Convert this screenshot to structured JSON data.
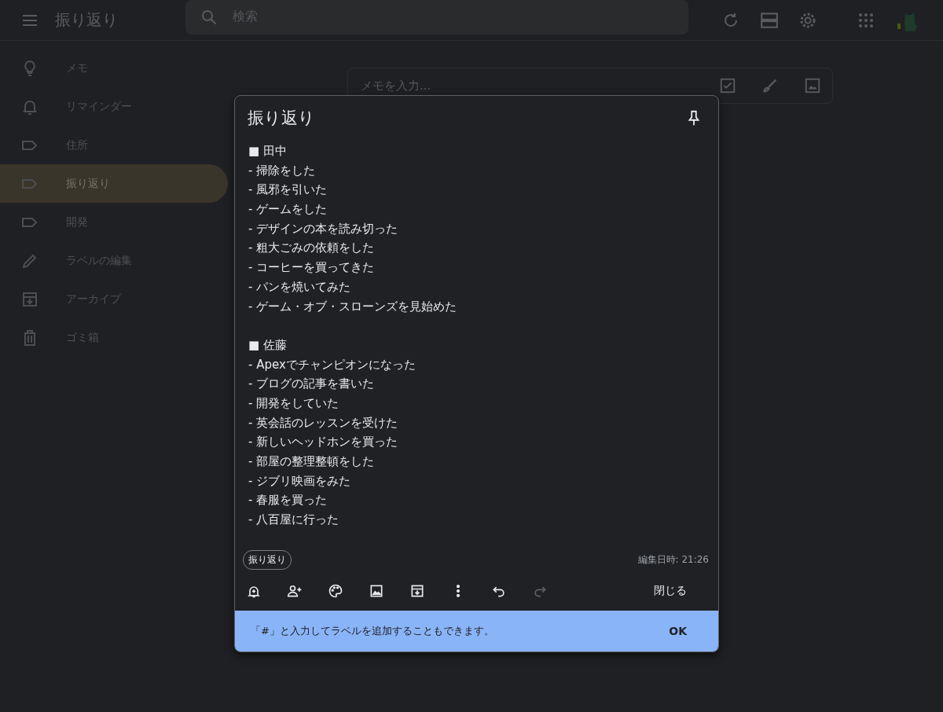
{
  "header": {
    "title": "振り返り",
    "search": {
      "placeholder": "検索"
    }
  },
  "sidebar": {
    "items": [
      {
        "label": "メモ",
        "kind": "bulb",
        "selected": false
      },
      {
        "label": "リマインダー",
        "kind": "bell",
        "selected": false
      },
      {
        "label": "住所",
        "kind": "label",
        "selected": false
      },
      {
        "label": "振り返り",
        "kind": "label",
        "selected": true
      },
      {
        "label": "開発",
        "kind": "label",
        "selected": false
      },
      {
        "label": "ラベルの編集",
        "kind": "pencil",
        "selected": false
      },
      {
        "label": "アーカイブ",
        "kind": "archive",
        "selected": false
      },
      {
        "label": "ゴミ箱",
        "kind": "trash",
        "selected": false
      }
    ]
  },
  "take_note": {
    "placeholder": "メモを入力..."
  },
  "note": {
    "title": "振り返り",
    "sections": [
      {
        "heading": "■ 田中",
        "lines": [
          "- 掃除をした",
          "- 風邪を引いた",
          "- ゲームをした",
          "- デザインの本を読み切った",
          "- 粗大ごみの依頼をした",
          "- コーヒーを買ってきた",
          "- パンを焼いてみた",
          "- ゲーム・オブ・スローンズを見始めた"
        ]
      },
      {
        "heading": "■ 佐藤",
        "lines": [
          "- Apexでチャンピオンになった",
          "- ブログの記事を書いた",
          "- 開発をしていた",
          "- 英会話のレッスンを受けた",
          "- 新しいヘッドホンを買った",
          "- 部屋の整理整頓をした",
          "- ジブリ映画をみた",
          "- 春服を買った",
          "- 八百屋に行った"
        ]
      }
    ],
    "label_chip": "振り返り",
    "edited": "編集日時: 21:26",
    "tools": [
      {
        "kind": "remind",
        "disabled": false
      },
      {
        "kind": "collab",
        "disabled": false
      },
      {
        "kind": "palette",
        "disabled": false
      },
      {
        "kind": "image",
        "disabled": false
      },
      {
        "kind": "archive",
        "disabled": false
      },
      {
        "kind": "more",
        "disabled": false
      },
      {
        "kind": "undo",
        "disabled": false
      },
      {
        "kind": "redo",
        "disabled": true
      }
    ],
    "close": "閉じる",
    "tip": {
      "text": "「#」と入力してラベルを追加することもできます。",
      "ok": "OK"
    }
  }
}
